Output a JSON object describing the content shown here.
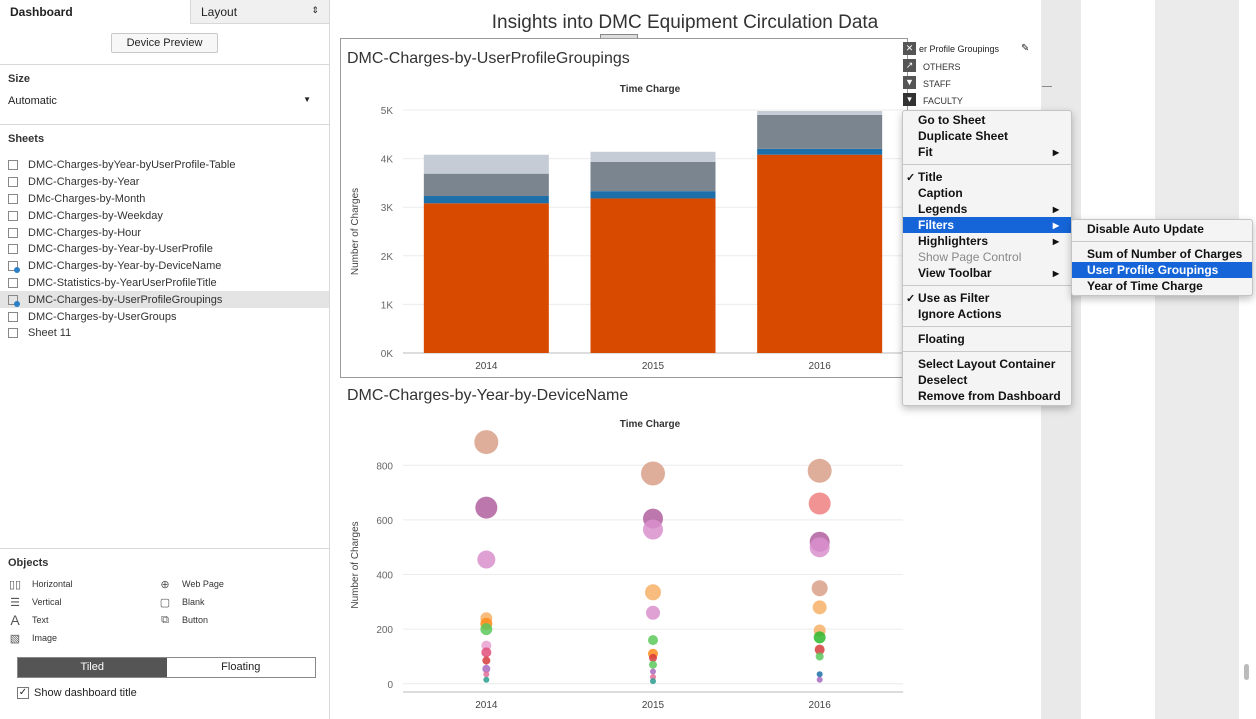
{
  "left_pane": {
    "tab_dashboard": "Dashboard",
    "tab_layout": "Layout",
    "device_preview": "Device Preview",
    "size_title": "Size",
    "size_value": "Automatic",
    "sheets_title": "Sheets",
    "sheets": [
      {
        "label": "DMC-Charges-byYear-byUserProfile-Table",
        "used": false,
        "selected": false
      },
      {
        "label": "DMC-Charges-by-Year",
        "used": false,
        "selected": false
      },
      {
        "label": "DMc-Charges-by-Month",
        "used": false,
        "selected": false
      },
      {
        "label": "DMC-Charges-by-Weekday",
        "used": false,
        "selected": false
      },
      {
        "label": "DMC-Charges-by-Hour",
        "used": false,
        "selected": false
      },
      {
        "label": "DMC-Charges-by-Year-by-UserProfile",
        "used": false,
        "selected": false
      },
      {
        "label": "DMC-Charges-by-Year-by-DeviceName",
        "used": true,
        "selected": false
      },
      {
        "label": "DMC-Statistics-by-YearUserProfileTitle",
        "used": false,
        "selected": false
      },
      {
        "label": "DMC-Charges-by-UserProfileGroupings",
        "used": true,
        "selected": true
      },
      {
        "label": "DMC-Charges-by-UserGroups",
        "used": false,
        "selected": false
      },
      {
        "label": "Sheet 11",
        "used": false,
        "selected": false
      }
    ],
    "objects_title": "Objects",
    "objects": {
      "horizontal": "Horizontal",
      "web_page": "Web Page",
      "vertical": "Vertical",
      "blank": "Blank",
      "text": "Text",
      "button": "Button",
      "image": "Image"
    },
    "tiled": "Tiled",
    "floating": "Floating",
    "show_dashboard_title": "Show dashboard title"
  },
  "dashboard": {
    "title": "Insights into DMC Equipment Circulation Data",
    "legend_title": "er Profile Groupings",
    "legend_items": [
      "OTHERS",
      "STAFF",
      "FACULTY"
    ]
  },
  "context_menu": {
    "items": [
      {
        "label": "Go to Sheet"
      },
      {
        "label": "Duplicate Sheet"
      },
      {
        "label": "Fit",
        "submenu": true
      },
      {
        "sep": true
      },
      {
        "label": "Title",
        "checked": true
      },
      {
        "label": "Caption"
      },
      {
        "label": "Legends",
        "submenu": true
      },
      {
        "label": "Filters",
        "submenu": true,
        "highlighted": true
      },
      {
        "label": "Highlighters",
        "submenu": true
      },
      {
        "label": "Show Page Control",
        "disabled": true
      },
      {
        "label": "View Toolbar",
        "submenu": true
      },
      {
        "sep": true
      },
      {
        "label": "Use as Filter",
        "checked": true
      },
      {
        "label": "Ignore Actions"
      },
      {
        "sep": true
      },
      {
        "label": "Floating"
      },
      {
        "sep": true
      },
      {
        "label": "Select Layout Container"
      },
      {
        "label": "Deselect"
      },
      {
        "label": "Remove from Dashboard"
      }
    ],
    "submenu": {
      "items": [
        {
          "label": "Disable Auto Update"
        },
        {
          "sep": true
        },
        {
          "label": "Sum of Number of Charges"
        },
        {
          "label": "User Profile Groupings",
          "highlighted": true
        },
        {
          "label": "Year of Time Charge"
        }
      ]
    }
  },
  "chart_data": [
    {
      "type": "bar",
      "title": "DMC-Charges-by-UserProfileGroupings",
      "subtitle": "Time Charge",
      "ylabel": "Number of Charges",
      "categories": [
        "2014",
        "2015",
        "2016"
      ],
      "ylim": [
        0,
        5000
      ],
      "yticks": [
        "0K",
        "1K",
        "2K",
        "3K",
        "4K",
        "5K"
      ],
      "stacked": true,
      "series": [
        {
          "color": "#d84a00",
          "values": [
            3080,
            3180,
            4080
          ]
        },
        {
          "color": "#1c6fa8",
          "values": [
            150,
            150,
            120
          ]
        },
        {
          "color": "#7b8590",
          "values": [
            460,
            600,
            700
          ]
        },
        {
          "color": "#c5ccd6",
          "values": [
            390,
            210,
            80
          ]
        }
      ]
    },
    {
      "type": "scatter",
      "title": "DMC-Charges-by-Year-by-DeviceName",
      "subtitle": "Time Charge",
      "ylabel": "Number of Charges",
      "categories": [
        "2014",
        "2015",
        "2016"
      ],
      "ylim": [
        -30,
        900
      ],
      "yticks": [
        0,
        200,
        400,
        600,
        800
      ],
      "points": [
        {
          "cat": 0,
          "y": 885,
          "size": 12,
          "color": "#d9a08a"
        },
        {
          "cat": 0,
          "y": 645,
          "size": 11,
          "color": "#b0609f"
        },
        {
          "cat": 0,
          "y": 455,
          "size": 9,
          "color": "#d98fcc"
        },
        {
          "cat": 0,
          "y": 240,
          "size": 6,
          "color": "#f7b267"
        },
        {
          "cat": 0,
          "y": 220,
          "size": 6,
          "color": "#ff8c1a"
        },
        {
          "cat": 0,
          "y": 200,
          "size": 6,
          "color": "#5ac85a"
        },
        {
          "cat": 0,
          "y": 140,
          "size": 5,
          "color": "#e8a0d0"
        },
        {
          "cat": 0,
          "y": 115,
          "size": 5,
          "color": "#e0507a"
        },
        {
          "cat": 0,
          "y": 85,
          "size": 4,
          "color": "#d63c3c"
        },
        {
          "cat": 0,
          "y": 55,
          "size": 4,
          "color": "#a86bc0"
        },
        {
          "cat": 0,
          "y": 35,
          "size": 3,
          "color": "#e36c9a"
        },
        {
          "cat": 0,
          "y": 15,
          "size": 3,
          "color": "#2a9d8f"
        },
        {
          "cat": 1,
          "y": 770,
          "size": 12,
          "color": "#d9a08a"
        },
        {
          "cat": 1,
          "y": 605,
          "size": 10,
          "color": "#b0609f"
        },
        {
          "cat": 1,
          "y": 565,
          "size": 10,
          "color": "#d98fcc"
        },
        {
          "cat": 1,
          "y": 335,
          "size": 8,
          "color": "#f7b267"
        },
        {
          "cat": 1,
          "y": 260,
          "size": 7,
          "color": "#d98fcc"
        },
        {
          "cat": 1,
          "y": 160,
          "size": 5,
          "color": "#5ac85a"
        },
        {
          "cat": 1,
          "y": 110,
          "size": 5,
          "color": "#ff8c1a"
        },
        {
          "cat": 1,
          "y": 95,
          "size": 4,
          "color": "#d63c3c"
        },
        {
          "cat": 1,
          "y": 70,
          "size": 4,
          "color": "#5ac85a"
        },
        {
          "cat": 1,
          "y": 45,
          "size": 3,
          "color": "#a86bc0"
        },
        {
          "cat": 1,
          "y": 25,
          "size": 3,
          "color": "#e36c9a"
        },
        {
          "cat": 1,
          "y": 10,
          "size": 3,
          "color": "#2a9d8f"
        },
        {
          "cat": 2,
          "y": 780,
          "size": 12,
          "color": "#d9a08a"
        },
        {
          "cat": 2,
          "y": 660,
          "size": 11,
          "color": "#f08080"
        },
        {
          "cat": 2,
          "y": 520,
          "size": 10,
          "color": "#b0609f"
        },
        {
          "cat": 2,
          "y": 500,
          "size": 10,
          "color": "#d98fcc"
        },
        {
          "cat": 2,
          "y": 350,
          "size": 8,
          "color": "#d9a08a"
        },
        {
          "cat": 2,
          "y": 280,
          "size": 7,
          "color": "#f7b267"
        },
        {
          "cat": 2,
          "y": 195,
          "size": 6,
          "color": "#f7b267"
        },
        {
          "cat": 2,
          "y": 170,
          "size": 6,
          "color": "#2db82d"
        },
        {
          "cat": 2,
          "y": 125,
          "size": 5,
          "color": "#d63c3c"
        },
        {
          "cat": 2,
          "y": 100,
          "size": 4,
          "color": "#5ac85a"
        },
        {
          "cat": 2,
          "y": 35,
          "size": 3,
          "color": "#1c6fa8"
        },
        {
          "cat": 2,
          "y": 15,
          "size": 3,
          "color": "#a86bc0"
        }
      ]
    }
  ]
}
